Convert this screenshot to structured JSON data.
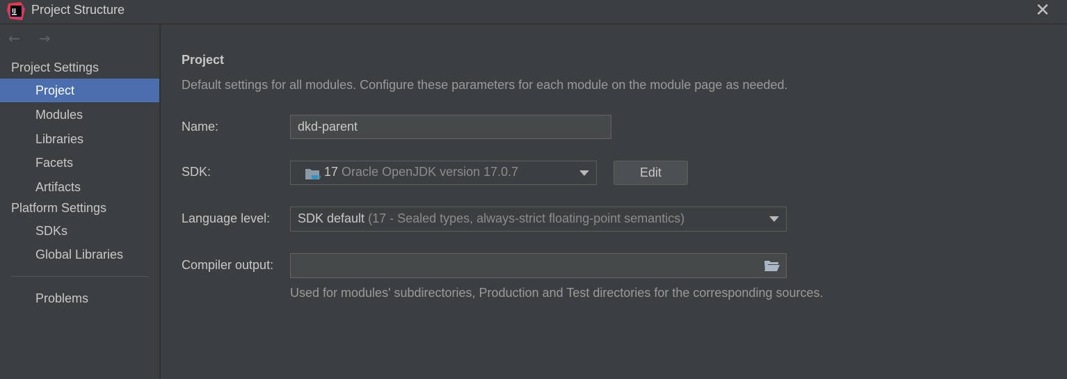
{
  "window": {
    "title": "Project Structure",
    "logo_text": "IJ"
  },
  "sidebar": {
    "nav": {
      "back": "←",
      "forward": "→"
    },
    "project_settings_header": "Project Settings",
    "project_settings_items": [
      {
        "label": "Project",
        "selected": true
      },
      {
        "label": "Modules"
      },
      {
        "label": "Libraries"
      },
      {
        "label": "Facets"
      },
      {
        "label": "Artifacts"
      }
    ],
    "platform_settings_header": "Platform Settings",
    "platform_settings_items": [
      {
        "label": "SDKs"
      },
      {
        "label": "Global Libraries"
      }
    ],
    "problems_label": "Problems"
  },
  "main": {
    "title": "Project",
    "description": "Default settings for all modules. Configure these parameters for each module on the module page as needed.",
    "name": {
      "label": "Name:",
      "value": "dkd-parent"
    },
    "sdk": {
      "label": "SDK:",
      "version": "17",
      "detail": "Oracle OpenJDK version 17.0.7",
      "edit_label": "Edit"
    },
    "language_level": {
      "label": "Language level:",
      "value": "SDK default",
      "detail": "(17 - Sealed types, always-strict floating-point semantics)"
    },
    "compiler_output": {
      "label": "Compiler output:",
      "value": "",
      "hint": "Used for modules' subdirectories, Production and Test directories for the corresponding sources."
    }
  },
  "colors": {
    "background": "#3c3f41",
    "selection": "#4b6eaf",
    "text": "#c8c8c8",
    "muted_text": "#9a9a9a"
  },
  "icons": [
    "intellij-logo-icon",
    "close-icon",
    "back-arrow-icon",
    "forward-arrow-icon",
    "jdk-folder-icon",
    "chevron-down-icon",
    "folder-browse-icon"
  ]
}
